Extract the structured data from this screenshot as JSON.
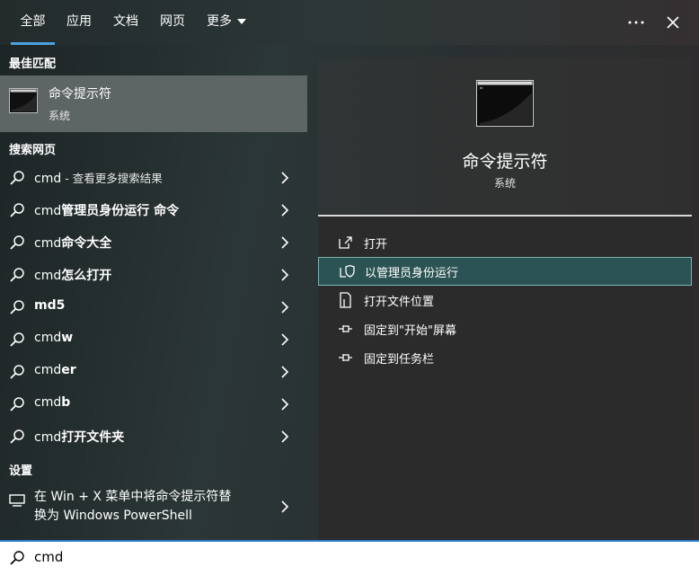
{
  "tabs": [
    {
      "label": "全部"
    },
    {
      "label": "应用"
    },
    {
      "label": "文档"
    },
    {
      "label": "网页"
    },
    {
      "label": "更多"
    }
  ],
  "icons": {
    "more": "ellipsis-icon",
    "close": "close-icon",
    "search": "magnifier-icon",
    "chevron": "chevron-right-icon"
  },
  "colors": {
    "accent": "#4aa3de",
    "highlight": "#2c5353",
    "best_match_bg": "#5e6565"
  },
  "left": {
    "best_match_header": "最佳匹配",
    "best_match": {
      "title": "命令提示符",
      "subtitle": "系统"
    },
    "web_header": "搜索网页",
    "web_results": [
      {
        "plain": "cmd",
        "bold": "",
        "light": " - 查看更多搜索结果"
      },
      {
        "plain": "cmd",
        "bold": "管理员身份运行 命令",
        "light": ""
      },
      {
        "plain": "cmd",
        "bold": "命令大全",
        "light": ""
      },
      {
        "plain": "cmd",
        "bold": "怎么打开",
        "light": ""
      },
      {
        "plain": "",
        "bold": "md5",
        "light": ""
      },
      {
        "plain": "cmd",
        "bold": "w",
        "light": ""
      },
      {
        "plain": "cmd",
        "bold": "er",
        "light": ""
      },
      {
        "plain": "cmd",
        "bold": "b",
        "light": ""
      },
      {
        "plain": "cmd",
        "bold": "打开文件夹",
        "light": ""
      }
    ],
    "settings_header": "设置",
    "settings_item": {
      "line1": "在 Win + X 菜单中将命令提示符替",
      "line2": "换为 Windows PowerShell"
    }
  },
  "detail": {
    "title": "命令提示符",
    "subtitle": "系统",
    "actions": [
      {
        "label": "打开",
        "icon": "open-external-icon"
      },
      {
        "label": "以管理员身份运行",
        "icon": "shield-icon"
      },
      {
        "label": "打开文件位置",
        "icon": "file-location-icon"
      },
      {
        "label": "固定到\"开始\"屏幕",
        "icon": "pin-icon"
      },
      {
        "label": "固定到任务栏",
        "icon": "pin-icon"
      }
    ]
  },
  "search": {
    "value": "cmd"
  }
}
